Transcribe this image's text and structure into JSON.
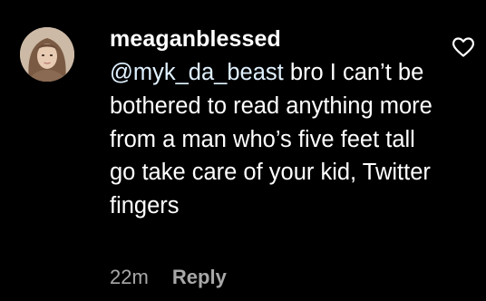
{
  "comment": {
    "username": "meaganblessed",
    "mention": "@myk_da_beast",
    "text": " bro I can’t be bothered to read anything more from a man who’s five feet tall go take care of your kid, Twitter fingers",
    "time": "22m",
    "reply_label": "Reply",
    "like_icon": "heart-outline-icon",
    "avatar_icon": "profile-photo"
  },
  "colors": {
    "background": "#000000",
    "text": "#ffffff",
    "secondary_text": "#a8a8a8"
  }
}
